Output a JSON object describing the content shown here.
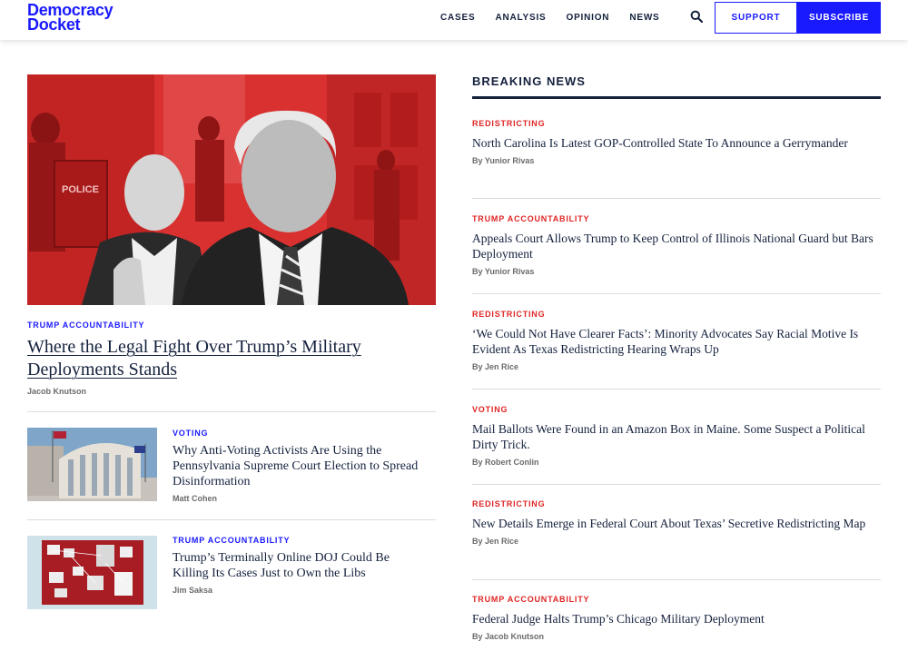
{
  "header": {
    "logo_line1": "Democracy",
    "logo_line2": "Docket",
    "nav": [
      "CASES",
      "ANALYSIS",
      "OPINION",
      "NEWS"
    ],
    "support_label": "SUPPORT",
    "subscribe_label": "SUBSCRIBE",
    "search_icon": "search-icon"
  },
  "colors": {
    "brand_blue": "#1a1aff",
    "tag_red": "#e02424",
    "navy": "#14213d",
    "hero_red": "#d92b2b"
  },
  "hero": {
    "image_text": "POLICE",
    "tag": "TRUMP ACCOUNTABILITY",
    "title": "Where the Legal Fight Over Trump’s Military Deployments Stands",
    "author": "Jacob Knutson"
  },
  "side_stories": [
    {
      "tag": "VOTING",
      "title": "Why Anti-Voting Activists Are Using the Pennsylvania Supreme Court Election to Spread Disinformation",
      "author": "Matt Cohen"
    },
    {
      "tag": "TRUMP ACCOUNTABILITY",
      "title": "Trump’s Terminally Online DOJ Could Be Killing Its Cases Just to Own the Libs",
      "author": "Jim Saksa"
    }
  ],
  "breaking": {
    "heading": "BREAKING NEWS",
    "items": [
      {
        "tag": "REDISTRICTING",
        "title": "North Carolina Is Latest GOP-Controlled State To Announce a Gerrymander",
        "byline": "By Yunior Rivas"
      },
      {
        "tag": "TRUMP ACCOUNTABILITY",
        "title": "Appeals Court Allows Trump to Keep Control of Illinois National Guard but Bars Deployment",
        "byline": "By Yunior Rivas"
      },
      {
        "tag": "REDISTRICTING",
        "title": "‘We Could Not Have Clearer Facts’: Minority Advocates Say Racial Motive Is Evident As Texas Redistricting Hearing Wraps Up",
        "byline": "By Jen Rice"
      },
      {
        "tag": "VOTING",
        "title": "Mail Ballots Were Found in an Amazon Box in Maine. Some Suspect a Political Dirty Trick.",
        "byline": "By Robert Conlin"
      },
      {
        "tag": "REDISTRICTING",
        "title": "New Details Emerge in Federal Court About Texas’ Secretive Redistricting Map",
        "byline": "By Jen Rice"
      },
      {
        "tag": "TRUMP ACCOUNTABILITY",
        "title": "Federal Judge Halts Trump’s Chicago Military Deployment",
        "byline": "By Jacob Knutson"
      }
    ]
  }
}
